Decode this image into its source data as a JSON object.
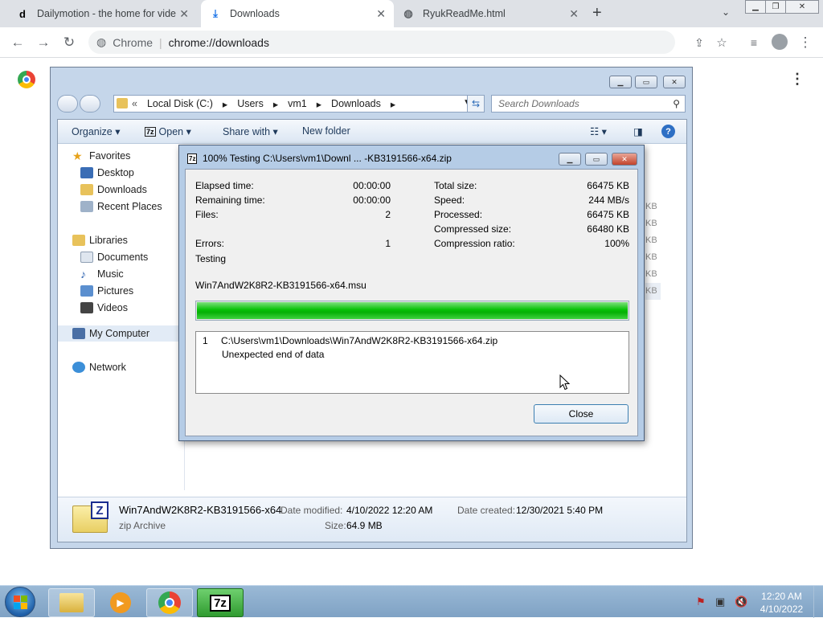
{
  "browser": {
    "tabs": [
      {
        "label": "Dailymotion - the home for vide",
        "favicon": "dailymotion-icon",
        "active": false
      },
      {
        "label": "Downloads",
        "favicon": "download-icon",
        "active": true
      },
      {
        "label": "RyukReadMe.html",
        "favicon": "globe-icon",
        "active": false
      }
    ],
    "omnibox_site": "Chrome",
    "omnibox_url": "chrome://downloads"
  },
  "explorer": {
    "breadcrumb": [
      "Local Disk (C:)",
      "Users",
      "vm1",
      "Downloads"
    ],
    "search_placeholder": "Search Downloads",
    "commands": {
      "organize": "Organize",
      "open": "Open",
      "share_with": "Share with",
      "new_folder": "New folder"
    },
    "nav": {
      "favorites": "Favorites",
      "desktop": "Desktop",
      "downloads": "Downloads",
      "recent_places": "Recent Places",
      "libraries": "Libraries",
      "documents": "Documents",
      "music": "Music",
      "pictures": "Pictures",
      "videos": "Videos",
      "my_computer": "My Computer",
      "network": "Network"
    },
    "size_column": [
      "KB",
      "KB",
      "KB",
      "KB",
      "KB",
      "KB"
    ],
    "details": {
      "filename": "Win7AndW2K8R2-KB3191566-x64",
      "type": "zip Archive",
      "date_modified_label": "Date modified:",
      "date_modified": "4/10/2022 12:20 AM",
      "size_label": "Size:",
      "size": "64.9 MB",
      "date_created_label": "Date created:",
      "date_created": "12/30/2021 5:40 PM"
    }
  },
  "sevenzip": {
    "title": "100% Testing C:\\Users\\vm1\\Downl ... -KB3191566-x64.zip",
    "left_stats": [
      {
        "label": "Elapsed time:",
        "value": "00:00:00"
      },
      {
        "label": "Remaining time:",
        "value": "00:00:00"
      },
      {
        "label": "Files:",
        "value": "2"
      },
      {
        "label": "",
        "value": ""
      },
      {
        "label": "Errors:",
        "value": "1"
      }
    ],
    "right_stats": [
      {
        "label": "Total size:",
        "value": "66475 KB"
      },
      {
        "label": "Speed:",
        "value": "244 MB/s"
      },
      {
        "label": "Processed:",
        "value": "66475 KB"
      },
      {
        "label": "Compressed size:",
        "value": "66480 KB"
      },
      {
        "label": "Compression ratio:",
        "value": "100%"
      }
    ],
    "status": "Testing",
    "current_file": "Win7AndW2K8R2-KB3191566-x64.msu",
    "progress_fraction": 1.0,
    "log": {
      "index": "1",
      "path": "C:\\Users\\vm1\\Downloads\\Win7AndW2K8R2-KB3191566-x64.zip",
      "message": "Unexpected end of data"
    },
    "close_label": "Close"
  },
  "taskbar": {
    "clock_time": "12:20 AM",
    "clock_date": "4/10/2022",
    "sevenzip_label": "7z"
  },
  "colors": {
    "progress": "#06c106",
    "taskbar": "#8aaed0",
    "explorer_frame": "#c5d6ea"
  }
}
